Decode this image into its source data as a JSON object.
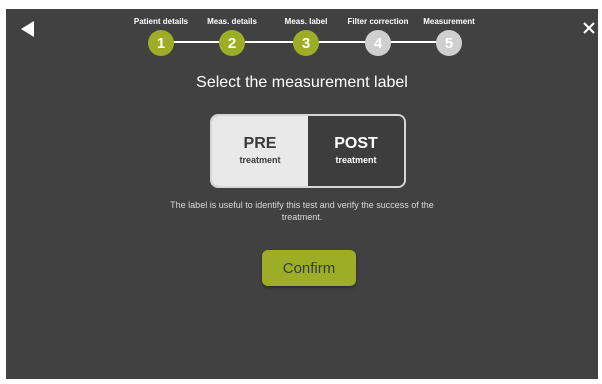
{
  "header": {
    "back_icon": "back-arrow-icon",
    "close_icon": "close-icon"
  },
  "stepper": {
    "steps": [
      {
        "number": "1",
        "label": "Patient details",
        "status": "done"
      },
      {
        "number": "2",
        "label": "Meas. details",
        "status": "done"
      },
      {
        "number": "3",
        "label": "Meas. label",
        "status": "current"
      },
      {
        "number": "4",
        "label": "Filter correction",
        "status": "todo"
      },
      {
        "number": "5",
        "label": "Measurement",
        "status": "todo"
      }
    ]
  },
  "main": {
    "title": "Select the measurement label",
    "options": [
      {
        "main": "PRE",
        "sub": "treatment",
        "selected": true
      },
      {
        "main": "POST",
        "sub": "treatment",
        "selected": false
      }
    ],
    "description": "The label is useful to identify this test and verify the success of the treatment.",
    "confirm_label": "Confirm"
  },
  "colors": {
    "background": "#414141",
    "accent": "#9dae26",
    "inactive_step": "#cfcfcf",
    "selected_option": "#e9e9e9"
  }
}
